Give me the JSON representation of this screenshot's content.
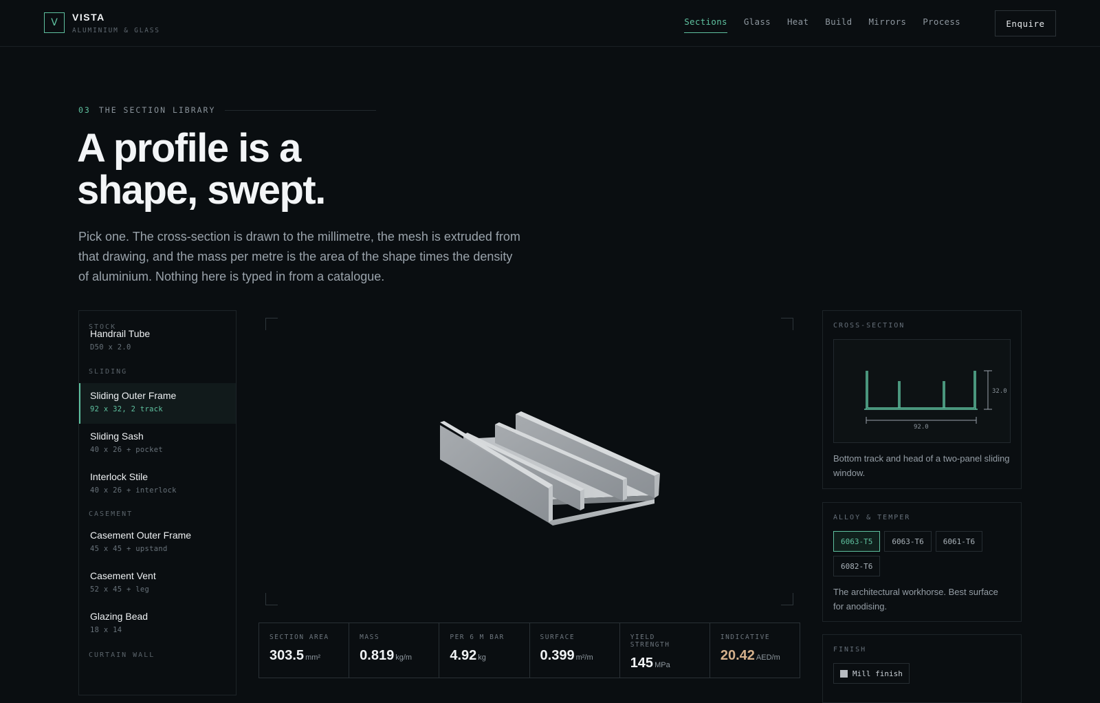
{
  "brand": {
    "initial": "V",
    "name": "VISTA",
    "tagline": "ALUMINIUM & GLASS"
  },
  "nav": {
    "items": [
      {
        "label": "Sections",
        "active": true
      },
      {
        "label": "Glass"
      },
      {
        "label": "Heat"
      },
      {
        "label": "Build"
      },
      {
        "label": "Mirrors"
      },
      {
        "label": "Process"
      }
    ],
    "cta": "Enquire"
  },
  "hero": {
    "eyebrow_num": "03",
    "eyebrow_label": "THE SECTION LIBRARY",
    "headline_1": "A profile is a",
    "headline_2": "shape, swept.",
    "lede": "Pick one. The cross-section is drawn to the millimetre, the mesh is extruded from that drawing, and the mass per metre is the area of the shape times the density of aluminium. Nothing here is typed in from a catalogue."
  },
  "stock": {
    "title": "STOCK",
    "partial_item": {
      "name": "Handrail Tube",
      "dims": "D50 x 2.0"
    },
    "groups": [
      {
        "label": "SLIDING",
        "items": [
          {
            "name": "Sliding Outer Frame",
            "dims": "92 x 32, 2 track",
            "selected": true
          },
          {
            "name": "Sliding Sash",
            "dims": "40 x 26 + pocket"
          },
          {
            "name": "Interlock Stile",
            "dims": "40 x 26 + interlock"
          }
        ]
      },
      {
        "label": "CASEMENT",
        "items": [
          {
            "name": "Casement Outer Frame",
            "dims": "45 x 45 + upstand"
          },
          {
            "name": "Casement Vent",
            "dims": "52 x 45 + leg"
          },
          {
            "name": "Glazing Bead",
            "dims": "18 x 14"
          }
        ]
      },
      {
        "label": "CURTAIN WALL",
        "items": []
      }
    ]
  },
  "stats": [
    {
      "label": "SECTION AREA",
      "value": "303.5",
      "unit": "mm²"
    },
    {
      "label": "MASS",
      "value": "0.819",
      "unit": "kg/m"
    },
    {
      "label": "PER 6 M BAR",
      "value": "4.92",
      "unit": "kg"
    },
    {
      "label": "SURFACE",
      "value": "0.399",
      "unit": "m²/m"
    },
    {
      "label": "YIELD STRENGTH",
      "value": "145",
      "unit": "MPa"
    },
    {
      "label": "INDICATIVE",
      "value": "20.42",
      "unit": "AED/m"
    }
  ],
  "cross_section": {
    "title": "CROSS-SECTION",
    "dim_height": "32.0",
    "dim_width": "92.0",
    "caption": "Bottom track and head of a two-panel sliding window."
  },
  "alloy": {
    "title": "ALLOY & TEMPER",
    "options": [
      {
        "label": "6063-T5",
        "selected": true
      },
      {
        "label": "6063-T6"
      },
      {
        "label": "6061-T6"
      },
      {
        "label": "6082-T6"
      }
    ],
    "caption": "The architectural workhorse. Best surface for anodising."
  },
  "finish": {
    "title": "FINISH",
    "options": [
      {
        "label": "Mill finish",
        "swatch": "#b7bcc1"
      }
    ]
  },
  "colors": {
    "accent": "#5fc2a0",
    "price": "#d5b18c",
    "background": "#0a0e11"
  }
}
